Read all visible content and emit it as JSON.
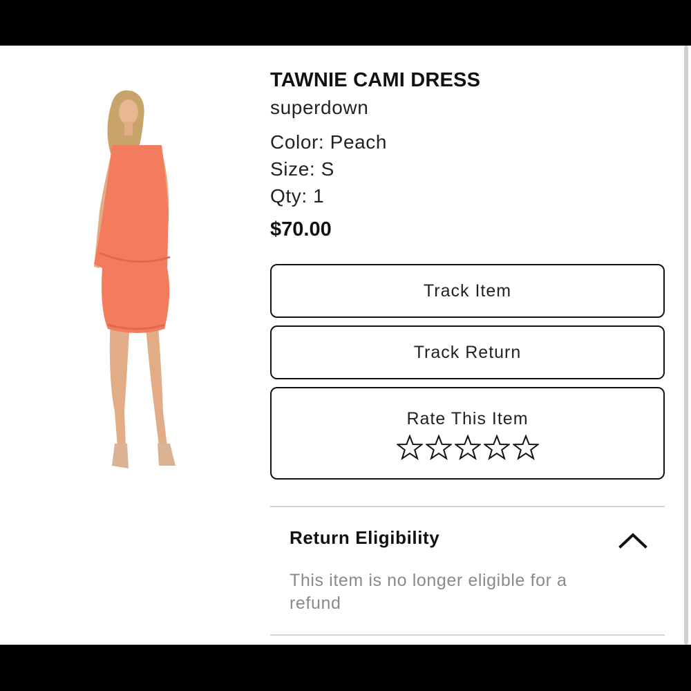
{
  "product": {
    "title": "TAWNIE CAMI DRESS",
    "brand": "superdown",
    "color": "Color: Peach",
    "size": "Size: S",
    "qty": "Qty: 1",
    "price": "$70.00",
    "dress_color": "#F47C5E"
  },
  "actions": {
    "track_item": "Track Item",
    "track_return": "Track Return",
    "rate_label": "Rate This Item",
    "rating": 0,
    "max_rating": 5
  },
  "return_eligibility": {
    "title": "Return Eligibility",
    "message": "This item is no longer eligible for a refund",
    "expanded": true,
    "toggle_icon": "chevron-up-icon"
  }
}
